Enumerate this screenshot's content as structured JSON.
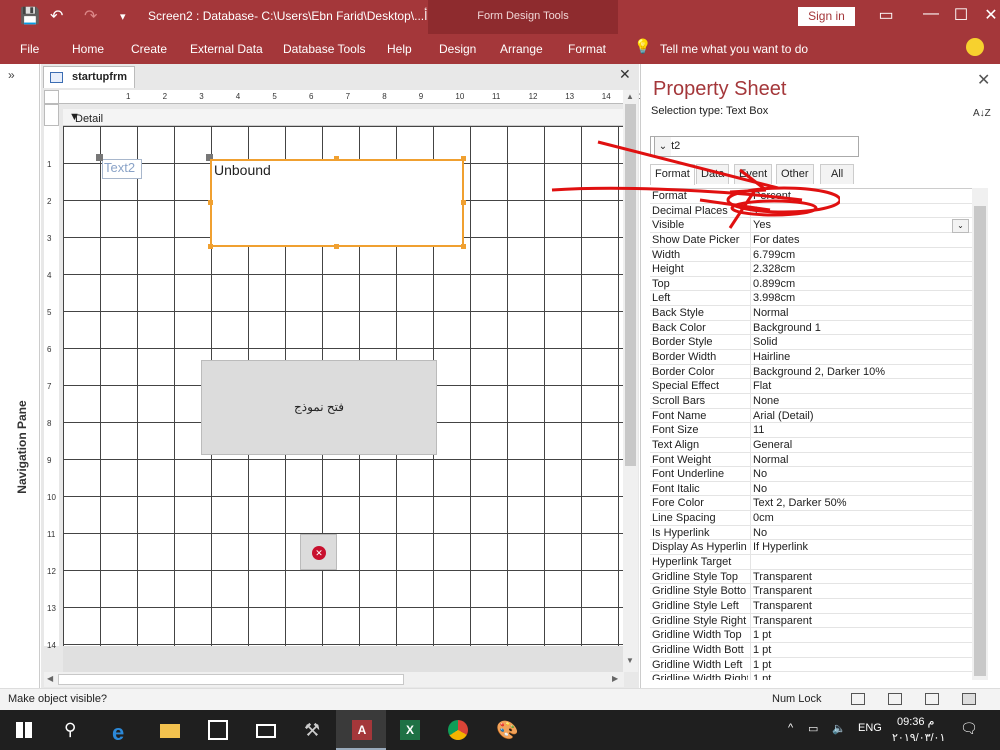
{
  "titlebar": {
    "title": "Screen2 : Database- C:\\Users\\Ebn Farid\\Desktop\\...أ",
    "context_tab_group": "Form Design Tools",
    "sign_in": "Sign in"
  },
  "ribbon": {
    "tabs": [
      "File",
      "Home",
      "Create",
      "External Data",
      "Database Tools",
      "Help",
      "Design",
      "Arrange",
      "Format"
    ],
    "tell_me": "Tell me what you want to do"
  },
  "nav_pane": {
    "label": "Navigation Pane"
  },
  "document": {
    "tab_label": "startupfrm",
    "section_label": "Detail",
    "ruler_h": [
      "1",
      "2",
      "3",
      "4",
      "5",
      "6",
      "7",
      "8",
      "9",
      "10",
      "11",
      "12",
      "13",
      "14",
      "15"
    ],
    "ruler_v": [
      "1",
      "2",
      "3",
      "4",
      "5",
      "6",
      "7",
      "8",
      "9",
      "10",
      "11",
      "12",
      "13",
      "14"
    ],
    "label_control": "Text2",
    "textbox_control": "Unbound",
    "command_button": "فتح نموذج"
  },
  "property_sheet": {
    "title": "Property Sheet",
    "selection_type": "Selection type:  Text Box",
    "selected_control": "Text2",
    "tabs": [
      "Format",
      "Data",
      "Event",
      "Other",
      "All"
    ],
    "active_tab": "Format",
    "rows": [
      {
        "name": "Format",
        "value": "Percent"
      },
      {
        "name": "Decimal Places",
        "value": "1"
      },
      {
        "name": "Visible",
        "value": "Yes"
      },
      {
        "name": "Show Date Picker",
        "value": "For dates"
      },
      {
        "name": "Width",
        "value": "6.799cm"
      },
      {
        "name": "Height",
        "value": "2.328cm"
      },
      {
        "name": "Top",
        "value": "0.899cm"
      },
      {
        "name": "Left",
        "value": "3.998cm"
      },
      {
        "name": "Back Style",
        "value": "Normal"
      },
      {
        "name": "Back Color",
        "value": "Background 1"
      },
      {
        "name": "Border Style",
        "value": "Solid"
      },
      {
        "name": "Border Width",
        "value": "Hairline"
      },
      {
        "name": "Border Color",
        "value": "Background 2, Darker 10%"
      },
      {
        "name": "Special Effect",
        "value": "Flat"
      },
      {
        "name": "Scroll Bars",
        "value": "None"
      },
      {
        "name": "Font Name",
        "value": "Arial (Detail)"
      },
      {
        "name": "Font Size",
        "value": "11"
      },
      {
        "name": "Text Align",
        "value": "General"
      },
      {
        "name": "Font Weight",
        "value": "Normal"
      },
      {
        "name": "Font Underline",
        "value": "No"
      },
      {
        "name": "Font Italic",
        "value": "No"
      },
      {
        "name": "Fore Color",
        "value": "Text 2, Darker 50%"
      },
      {
        "name": "Line Spacing",
        "value": "0cm"
      },
      {
        "name": "Is Hyperlink",
        "value": "No"
      },
      {
        "name": "Display As Hyperlin",
        "value": "If Hyperlink"
      },
      {
        "name": "Hyperlink Target",
        "value": ""
      },
      {
        "name": "Gridline Style Top",
        "value": "Transparent"
      },
      {
        "name": "Gridline Style Botto",
        "value": "Transparent"
      },
      {
        "name": "Gridline Style Left",
        "value": "Transparent"
      },
      {
        "name": "Gridline Style Right",
        "value": "Transparent"
      },
      {
        "name": "Gridline Width Top",
        "value": "1 pt"
      },
      {
        "name": "Gridline Width Bott",
        "value": "1 pt"
      },
      {
        "name": "Gridline Width Left",
        "value": "1 pt"
      },
      {
        "name": "Gridline Width Right",
        "value": "1 pt"
      }
    ]
  },
  "statusbar": {
    "message": "Make object visible?",
    "num_lock": "Num Lock"
  },
  "taskbar": {
    "language": "ENG",
    "time": "09:36 م",
    "date": "٢٠١٩/٠٣/٠١"
  },
  "colors": {
    "accent": "#a4373a",
    "selection": "#f0a030",
    "annotation": "#e01010"
  }
}
